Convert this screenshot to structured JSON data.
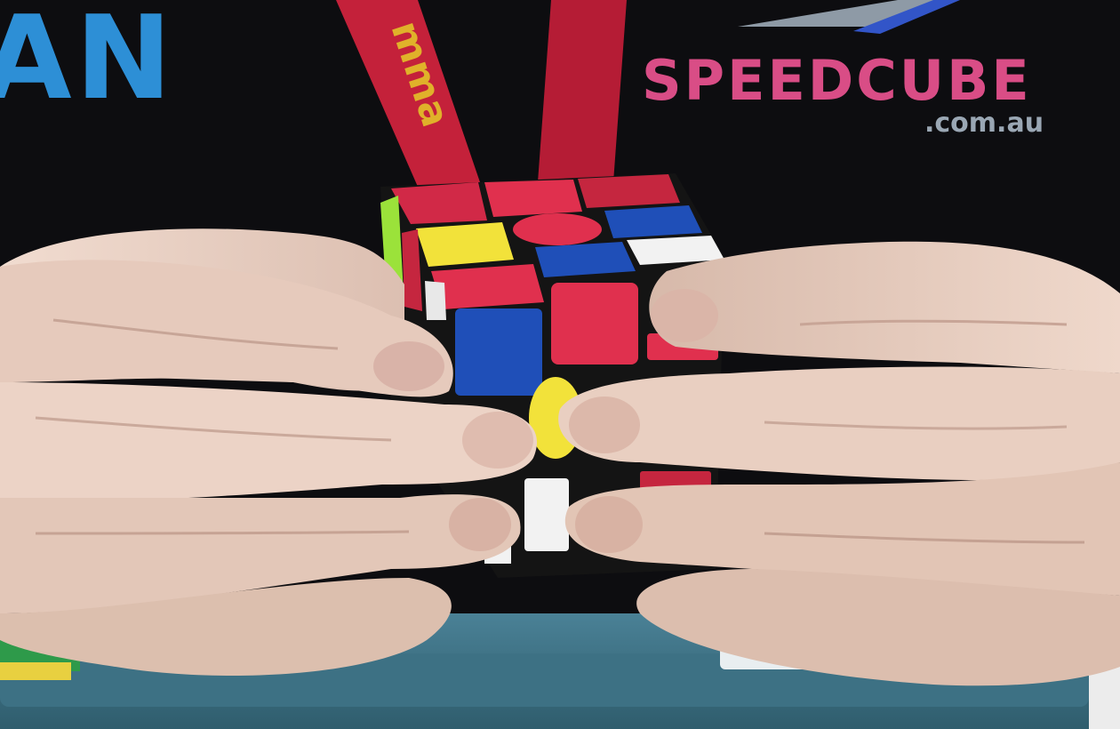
{
  "scene": {
    "description_free": true,
    "shirt": {
      "brand_left_fragment": "AN",
      "brand_right": "SPEEDCUBE",
      "brand_right_sub": ".com.au",
      "lanyard_text": "mma"
    },
    "colors": {
      "shirt": "#0d0d10",
      "lanyard": "#c4213a",
      "lanyard_text": "#e0b12a",
      "brand_left": "#2d8fd6",
      "skin": "#e7cfc2",
      "skin_shadow": "#c9a898",
      "cube_body": "#141414",
      "red": "#e0304e",
      "blue": "#1f4fb8",
      "yellow": "#f2e23a",
      "green": "#9be23a",
      "white": "#f2f2f2",
      "mat": "#3b6e80"
    },
    "icons": [
      "speedcube-logo",
      "rubiks-cube"
    ]
  }
}
